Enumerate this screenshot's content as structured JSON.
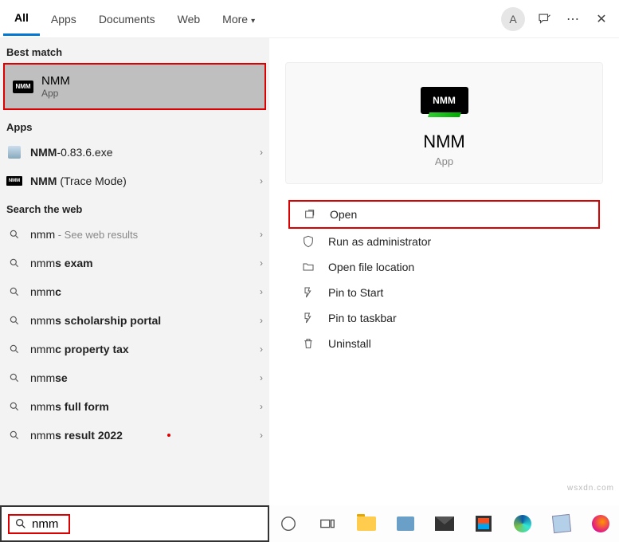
{
  "tabs": {
    "all": "All",
    "apps": "Apps",
    "documents": "Documents",
    "web": "Web",
    "more": "More"
  },
  "avatar_letter": "A",
  "sections": {
    "best_match": "Best match",
    "apps": "Apps",
    "search_web": "Search the web"
  },
  "best_match": {
    "icon_text": "NMM",
    "title": "NMM",
    "subtitle": "App"
  },
  "apps_results": [
    {
      "label_bold": "NMM",
      "label_rest": "-0.83.6.exe",
      "icon": "exe"
    },
    {
      "label_bold": "NMM",
      "label_rest": " (Trace Mode)",
      "icon": "nmm"
    }
  ],
  "web_results": [
    {
      "prefix": "nmm",
      "bold": "",
      "suffix_grey": " - See web results"
    },
    {
      "prefix": "nmm",
      "bold": "s exam",
      "suffix_grey": ""
    },
    {
      "prefix": "nmm",
      "bold": "c",
      "suffix_grey": ""
    },
    {
      "prefix": "nmm",
      "bold": "s scholarship portal",
      "suffix_grey": ""
    },
    {
      "prefix": "nmm",
      "bold": "c property tax",
      "suffix_grey": ""
    },
    {
      "prefix": "nmm",
      "bold": "se",
      "suffix_grey": ""
    },
    {
      "prefix": "nmm",
      "bold": "s full form",
      "suffix_grey": ""
    },
    {
      "prefix": "nmm",
      "bold": "s result 2022",
      "suffix_grey": ""
    }
  ],
  "detail": {
    "logo_text": "NMM",
    "title": "NMM",
    "subtitle": "App"
  },
  "actions": [
    {
      "label": "Open",
      "icon": "open",
      "highlighted": true
    },
    {
      "label": "Run as administrator",
      "icon": "shield",
      "highlighted": false
    },
    {
      "label": "Open file location",
      "icon": "folder",
      "highlighted": false
    },
    {
      "label": "Pin to Start",
      "icon": "pin",
      "highlighted": false
    },
    {
      "label": "Pin to taskbar",
      "icon": "pin",
      "highlighted": false
    },
    {
      "label": "Uninstall",
      "icon": "trash",
      "highlighted": false
    }
  ],
  "search": {
    "value": "nmm"
  },
  "watermark": "wsxdn.com"
}
